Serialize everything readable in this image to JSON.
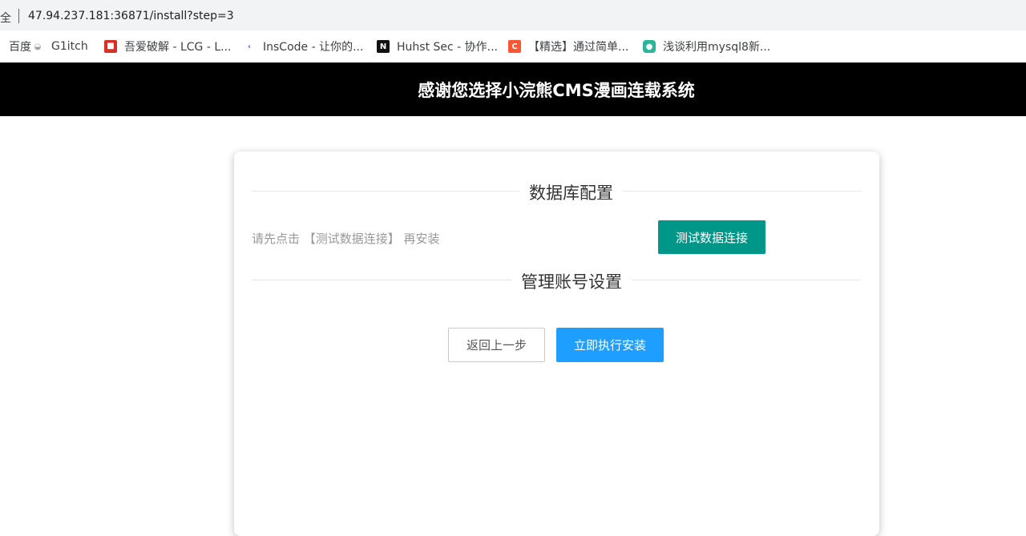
{
  "browser": {
    "address_prefix": "全",
    "url": "47.94.237.181:36871/install?step=3",
    "bookmarks": [
      {
        "icon": "baidu-icon",
        "label": "百度"
      },
      {
        "icon": "g1itch-icon",
        "label": "G1itch"
      },
      {
        "icon": "52pojie-icon",
        "label": "吾爱破解 - LCG - L..."
      },
      {
        "icon": "inscode-icon",
        "label": "InsCode - 让你的..."
      },
      {
        "icon": "huhst-icon",
        "label": "Huhst Sec - 协作..."
      },
      {
        "icon": "csdn-icon",
        "label": "【精选】通过简单..."
      },
      {
        "icon": "article-icon",
        "label": "浅谈利用mysql8新..."
      }
    ]
  },
  "header": {
    "title": "感谢您选择小浣熊CMS漫画连载系统"
  },
  "install": {
    "db_section_title": "数据库配置",
    "db_hint": "请先点击 【测试数据连接】 再安装",
    "test_button": "测试数据连接",
    "admin_section_title": "管理账号设置",
    "back_button": "返回上一步",
    "install_button": "立即执行安装"
  },
  "colors": {
    "header_bg": "#000000",
    "test_button": "#009688",
    "install_button": "#1e9fff"
  }
}
